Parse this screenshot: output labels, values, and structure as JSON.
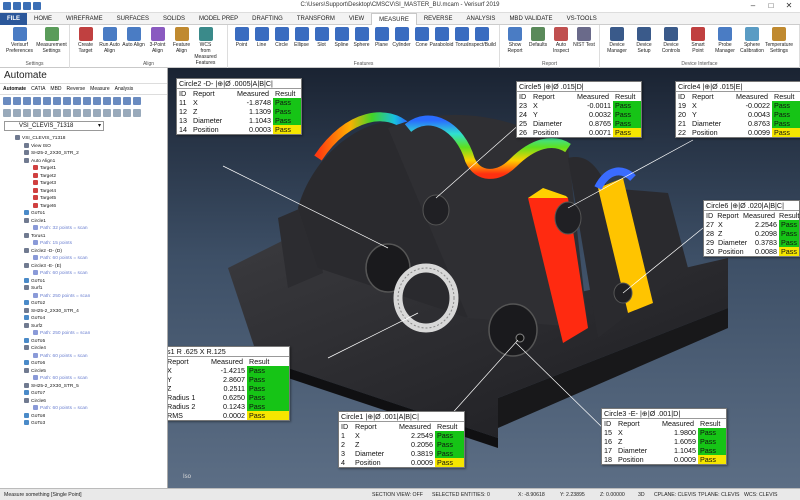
{
  "window": {
    "title": "C:\\Users\\Support\\Desktop\\CMSCV\\SI_MASTER_BU.mcam - Verisurf 2019"
  },
  "menu": {
    "file": "FILE",
    "tabs": [
      "HOME",
      "WIREFRAME",
      "SURFACES",
      "SOLIDS",
      "MODEL PREP",
      "DRAFTING",
      "TRANSFORM",
      "VIEW",
      "MEASURE",
      "REVERSE",
      "ANALYSIS",
      "MBD VALIDATE",
      "VS-TOOLS"
    ],
    "active": "MEASURE"
  },
  "ribbon": {
    "settings": {
      "label": "Settings",
      "buttons": [
        "Verisurf Preferences",
        "Measurement Settings"
      ]
    },
    "align": {
      "label": "Align",
      "buttons": [
        "Create Target",
        "Run Auto Align",
        "Auto Align",
        "3-Point Align",
        "Feature Align",
        "WCS from Measured Features"
      ]
    },
    "features": {
      "label": "Features",
      "buttons": [
        "Point",
        "Line",
        "Circle",
        "Ellipse",
        "Slot",
        "Spline",
        "Sphere",
        "Plane",
        "Cylinder",
        "Cone",
        "Paraboloid",
        "Torus",
        "Inspect/Build"
      ]
    },
    "report": {
      "label": "Report",
      "buttons": [
        "Show Report",
        "Defaults",
        "Auto Inspect",
        "NIST Test"
      ]
    },
    "device": {
      "label": "Device Interface",
      "buttons": [
        "Device Manager",
        "Device Setup",
        "Device Controls",
        "Smart Point",
        "Probe Manager",
        "Sphere Calibration",
        "Temperature Settings"
      ]
    }
  },
  "leftpanel": {
    "title": "Automate",
    "tabs": [
      "Automate",
      "CATIA",
      "MBD",
      "Reverse",
      "Measure",
      "Analysis"
    ],
    "active_tab": "Automate",
    "combo": "VSI_CLEVIS_71318",
    "tree": [
      {
        "label": "VSI_CLEVIS_71318",
        "indent": 1,
        "sub": false
      },
      {
        "label": "View ISO",
        "indent": 2,
        "sub": false
      },
      {
        "label": "SH25-2_2X30_STR_2",
        "indent": 2,
        "sub": false
      },
      {
        "label": "Auto Align1",
        "indent": 2,
        "sub": false
      },
      {
        "label": "Target1",
        "indent": 3,
        "sub": false
      },
      {
        "label": "Target2",
        "indent": 3,
        "sub": false
      },
      {
        "label": "Target3",
        "indent": 3,
        "sub": false
      },
      {
        "label": "Target4",
        "indent": 3,
        "sub": false
      },
      {
        "label": "Target5",
        "indent": 3,
        "sub": false
      },
      {
        "label": "Target6",
        "indent": 3,
        "sub": false
      },
      {
        "label": "GoTo1",
        "indent": 2,
        "sub": false
      },
      {
        "label": "Circle1",
        "indent": 2,
        "sub": false
      },
      {
        "label": "Path: 32 points = scan",
        "indent": 3,
        "sub": true
      },
      {
        "label": "Torus1",
        "indent": 2,
        "sub": false
      },
      {
        "label": "Path: 15 points",
        "indent": 3,
        "sub": true
      },
      {
        "label": "Circle2 -D- (D)",
        "indent": 2,
        "sub": false
      },
      {
        "label": "Path: 60 points = scan",
        "indent": 3,
        "sub": true
      },
      {
        "label": "Circle3 -E- (E)",
        "indent": 2,
        "sub": false
      },
      {
        "label": "Path: 60 points = scan",
        "indent": 3,
        "sub": true
      },
      {
        "label": "GoTo1",
        "indent": 2,
        "sub": false
      },
      {
        "label": "Surf1",
        "indent": 2,
        "sub": false
      },
      {
        "label": "Path: 250 points = scan",
        "indent": 3,
        "sub": true
      },
      {
        "label": "GoTo2",
        "indent": 2,
        "sub": false
      },
      {
        "label": "SH25-2_2X30_STR_4",
        "indent": 2,
        "sub": false
      },
      {
        "label": "GoTo4",
        "indent": 2,
        "sub": false
      },
      {
        "label": "Surf2",
        "indent": 2,
        "sub": false
      },
      {
        "label": "Path: 250 points = scan",
        "indent": 3,
        "sub": true
      },
      {
        "label": "GoTo5",
        "indent": 2,
        "sub": false
      },
      {
        "label": "Circle4",
        "indent": 2,
        "sub": false
      },
      {
        "label": "Path: 60 points = scan",
        "indent": 3,
        "sub": true
      },
      {
        "label": "GoTo6",
        "indent": 2,
        "sub": false
      },
      {
        "label": "Circle5",
        "indent": 2,
        "sub": false
      },
      {
        "label": "Path: 60 points = scan",
        "indent": 3,
        "sub": true
      },
      {
        "label": "SH25-2_2X30_STR_5",
        "indent": 2,
        "sub": false
      },
      {
        "label": "GoTo7",
        "indent": 2,
        "sub": false
      },
      {
        "label": "Circle6",
        "indent": 2,
        "sub": false
      },
      {
        "label": "Path: 60 points = scan",
        "indent": 3,
        "sub": true
      },
      {
        "label": "GoTo8",
        "indent": 2,
        "sub": false
      },
      {
        "label": "GoTo3",
        "indent": 2,
        "sub": false
      }
    ]
  },
  "viewport": {
    "iso_label": "Iso"
  },
  "callouts": [
    {
      "id": "circle2",
      "header": "Circle2 -D- |⊕|Ø .0005|A|B|C|",
      "cols": [
        "ID",
        "Report",
        "Measured",
        "Result"
      ],
      "rows": [
        [
          "11",
          "X",
          "-1.8748",
          "Pass"
        ],
        [
          "12",
          "Z",
          "1.1309",
          "Pass"
        ],
        [
          "13",
          "Diameter",
          "1.1043",
          "Pass"
        ],
        [
          "14",
          "Position",
          "0.0003",
          "Pass"
        ]
      ]
    },
    {
      "id": "circle5",
      "header": "Circle5 |⊕|Ø .015|D|",
      "cols": [
        "ID",
        "Report",
        "Measured",
        "Result"
      ],
      "rows": [
        [
          "23",
          "X",
          "-0.0011",
          "Pass"
        ],
        [
          "24",
          "Y",
          "0.0032",
          "Pass"
        ],
        [
          "25",
          "Diameter",
          "0.8765",
          "Pass"
        ],
        [
          "26",
          "Position",
          "0.0071",
          "Pass"
        ]
      ]
    },
    {
      "id": "circle4",
      "header": "Circle4 |⊕|Ø .015|E|",
      "cols": [
        "ID",
        "Report",
        "Measured",
        "Result"
      ],
      "rows": [
        [
          "19",
          "X",
          "-0.0022",
          "Pass"
        ],
        [
          "20",
          "Y",
          "0.0043",
          "Pass"
        ],
        [
          "21",
          "Diameter",
          "0.8763",
          "Pass"
        ],
        [
          "22",
          "Position",
          "0.0099",
          "Pass"
        ]
      ]
    },
    {
      "id": "circle6",
      "header": "Circle6 |⊕|Ø .020|A|B|C|",
      "cols": [
        "ID",
        "Report",
        "Measured",
        "Result"
      ],
      "rows": [
        [
          "27",
          "X",
          "2.2546",
          "Pass"
        ],
        [
          "28",
          "Z",
          "0.2098",
          "Pass"
        ],
        [
          "29",
          "Diameter",
          "0.3783",
          "Pass"
        ],
        [
          "30",
          "Position",
          "0.0088",
          "Pass"
        ]
      ]
    },
    {
      "id": "torus1",
      "header": "Torus1 R .625 X R.125",
      "cols": [
        "ID",
        "Report",
        "Measured",
        "Result"
      ],
      "rows": [
        [
          "5",
          "X",
          "-1.4215",
          "Pass"
        ],
        [
          "6",
          "Y",
          "2.8607",
          "Pass"
        ],
        [
          "7",
          "Z",
          "0.2511",
          "Pass"
        ],
        [
          "8",
          "Radius 1",
          "0.6250",
          "Pass"
        ],
        [
          "9",
          "Radius 2",
          "0.1243",
          "Pass"
        ],
        [
          "10",
          "RMS",
          "0.0002",
          "Pass"
        ]
      ]
    },
    {
      "id": "circle1",
      "header": "Circle1 |⊕|Ø .001|A|B|C|",
      "cols": [
        "ID",
        "Report",
        "Measured",
        "Result"
      ],
      "rows": [
        [
          "1",
          "X",
          "2.2549",
          "Pass"
        ],
        [
          "2",
          "Z",
          "0.2056",
          "Pass"
        ],
        [
          "3",
          "Diameter",
          "0.3819",
          "Pass"
        ],
        [
          "4",
          "Position",
          "0.0009",
          "Pass"
        ]
      ]
    },
    {
      "id": "circle3",
      "header": "Circle3 -E- |⊕|Ø .001|D|",
      "cols": [
        "ID",
        "Report",
        "Measured",
        "Result"
      ],
      "rows": [
        [
          "15",
          "X",
          "1.9800",
          "Pass"
        ],
        [
          "16",
          "Z",
          "1.6059",
          "Pass"
        ],
        [
          "17",
          "Diameter",
          "1.1045",
          "Pass"
        ],
        [
          "18",
          "Position",
          "0.0009",
          "Pass"
        ]
      ]
    }
  ],
  "status": {
    "left": "Measure something [Single Point]",
    "section": "SECTION VIEW: OFF",
    "selected": "SELECTED ENTITIES: 0",
    "x": "X: -8.90618",
    "y": "Y: 2.23895",
    "z": "Z: 0.00000",
    "mode": "3D",
    "cplane": "CPLANE: CLEVIS",
    "tplane": "TPLANE: CLEVIS",
    "wcs": "WCS: CLEVIS"
  },
  "colors": {
    "pass": "#16c416",
    "position_pass": "#f5e600",
    "file_tab": "#2b579a"
  }
}
